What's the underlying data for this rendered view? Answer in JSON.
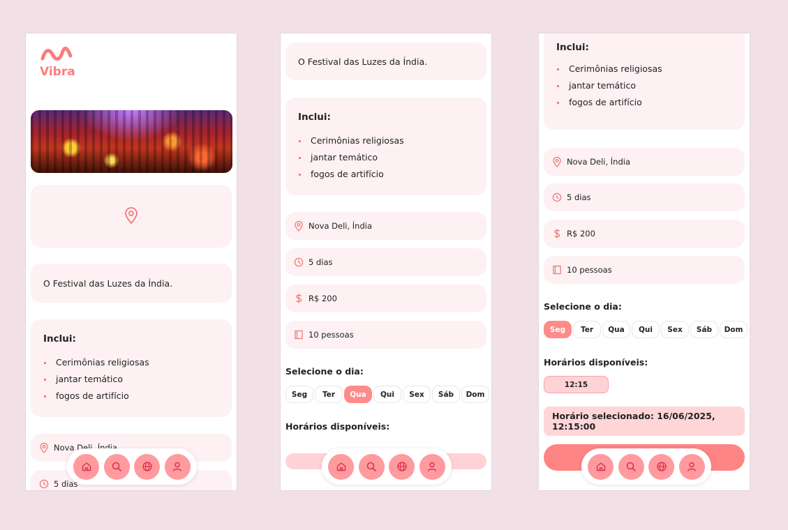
{
  "app": {
    "name": "Vibra"
  },
  "event": {
    "description": "O Festival das Luzes da Índia.",
    "includes_title": "Inclui:",
    "includes": [
      "Cerimônias religiosas",
      "jantar temático",
      "fogos de artifício"
    ],
    "location": "Nova Deli, Índia",
    "duration": "5 dias",
    "price": "R$ 200",
    "capacity": "10 pessoas"
  },
  "booking": {
    "select_day_label": "Selecione o dia:",
    "days": [
      "Seg",
      "Ter",
      "Qua",
      "Qui",
      "Sex",
      "Sáb",
      "Dom"
    ],
    "screen2_active_day": "Qua",
    "screen3_active_day": "Seg",
    "times_label": "Horários disponíveis:",
    "times": [
      "12:15"
    ],
    "selected_time_text": "Horário selecionado: 16/06/2025, 12:15:00"
  },
  "nav": {
    "items": [
      {
        "name": "home",
        "icon": "home-icon"
      },
      {
        "name": "search",
        "icon": "search-icon"
      },
      {
        "name": "explore",
        "icon": "globe-icon"
      },
      {
        "name": "profile",
        "icon": "user-icon"
      }
    ]
  },
  "colors": {
    "background": "#f1e1e7",
    "accent": "#ff8a8a",
    "card": "#fdf1f3",
    "nav_button": "#ff9a9e",
    "icon": "#f07878"
  }
}
